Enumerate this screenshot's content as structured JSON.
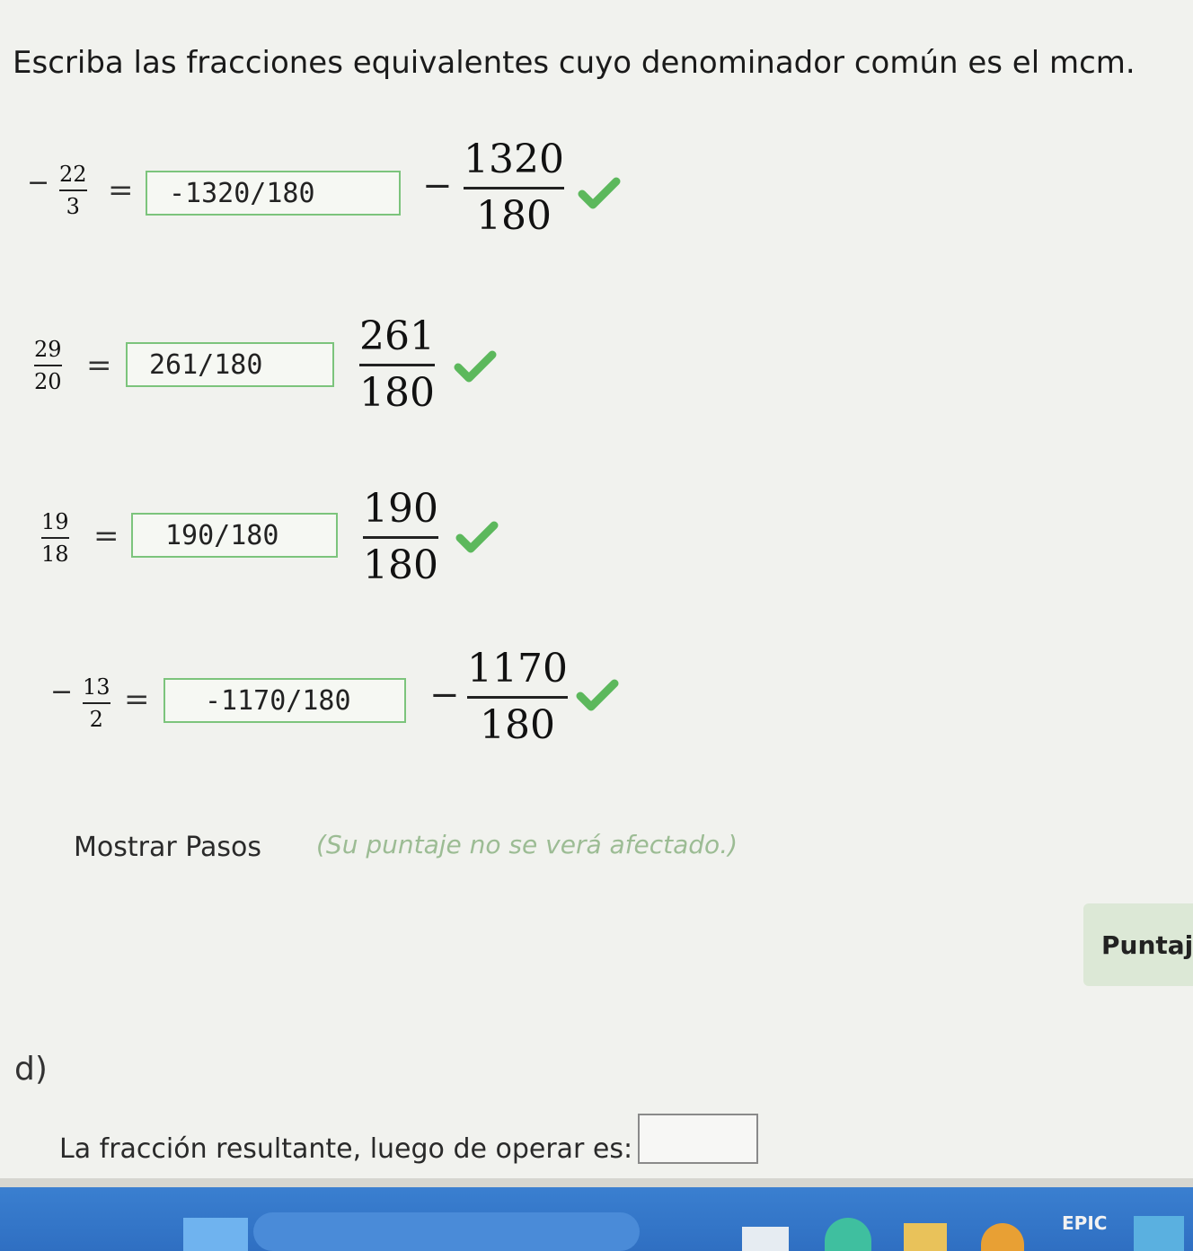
{
  "instruction": "Escriba las fracciones equivalentes cuyo denominador común es el mcm.",
  "rows": [
    {
      "negative": true,
      "given": {
        "num": "22",
        "den": "3"
      },
      "equals": "=",
      "answer": "-1320/180",
      "preview": {
        "num": "1320",
        "den": "180"
      },
      "status": "correct"
    },
    {
      "negative": false,
      "given": {
        "num": "29",
        "den": "20"
      },
      "equals": "=",
      "answer": "261/180",
      "preview": {
        "num": "261",
        "den": "180"
      },
      "status": "correct"
    },
    {
      "negative": false,
      "given": {
        "num": "19",
        "den": "18"
      },
      "equals": "=",
      "answer": "190/180",
      "preview": {
        "num": "190",
        "den": "180"
      },
      "status": "correct"
    },
    {
      "negative": true,
      "given": {
        "num": "13",
        "den": "2"
      },
      "equals": "=",
      "answer": "-1170/180",
      "preview": {
        "num": "1170",
        "den": "180"
      },
      "status": "correct"
    }
  ],
  "show_steps": {
    "label": "Mostrar Pasos",
    "note": "(Su puntaje no se verá afectado.)"
  },
  "score": {
    "label": "Puntaj"
  },
  "section": {
    "letter": "d)",
    "result_label": "La fracción resultante, luego de operar es:",
    "result_value": ""
  },
  "taskbar": {
    "epic_label": "EPIC"
  },
  "colors": {
    "check_green": "#5cb85c",
    "answer_border": "#7cc47c",
    "note_text": "#9cbc94",
    "taskbar": "#3a7fd0"
  }
}
